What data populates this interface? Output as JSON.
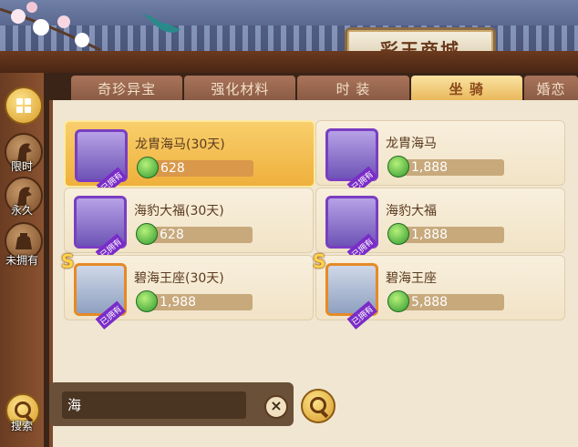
{
  "shop": {
    "title": "彩玉商城"
  },
  "tabs": [
    {
      "label": "奇珍异宝",
      "active": false
    },
    {
      "label": "强化材料",
      "active": false
    },
    {
      "label": "时 装",
      "active": false
    },
    {
      "label": "坐 骑",
      "active": true
    },
    {
      "label": "婚恋",
      "active": false
    }
  ],
  "sidebar": {
    "items": [
      {
        "label": "",
        "icon": "grid-icon"
      },
      {
        "label": "限时",
        "icon": "horse-icon"
      },
      {
        "label": "永久",
        "icon": "horse-icon"
      },
      {
        "label": "未拥有",
        "icon": "bag-icon"
      }
    ],
    "search_label": "搜索"
  },
  "items": [
    {
      "name": "龙胄海马(30天)",
      "price": "628",
      "owned_tag": "已拥有",
      "s_rank": false,
      "selected": true
    },
    {
      "name": "龙胄海马",
      "price": "1,888",
      "owned_tag": "已拥有",
      "s_rank": false,
      "selected": false
    },
    {
      "name": "海豹大福(30天)",
      "price": "628",
      "owned_tag": "已拥有",
      "s_rank": false,
      "selected": false
    },
    {
      "name": "海豹大福",
      "price": "1,888",
      "owned_tag": "已拥有",
      "s_rank": false,
      "selected": false
    },
    {
      "name": "碧海王座(30天)",
      "price": "1,988",
      "owned_tag": "已拥有",
      "s_rank": true,
      "selected": false
    },
    {
      "name": "碧海王座",
      "price": "5,888",
      "owned_tag": "已拥有",
      "s_rank": true,
      "selected": false
    }
  ],
  "search": {
    "value": "海",
    "rank_badge": "S"
  },
  "colors": {
    "accent": "#efb03c",
    "panel": "#f0e6d2",
    "gem": "#2f9a2f"
  }
}
